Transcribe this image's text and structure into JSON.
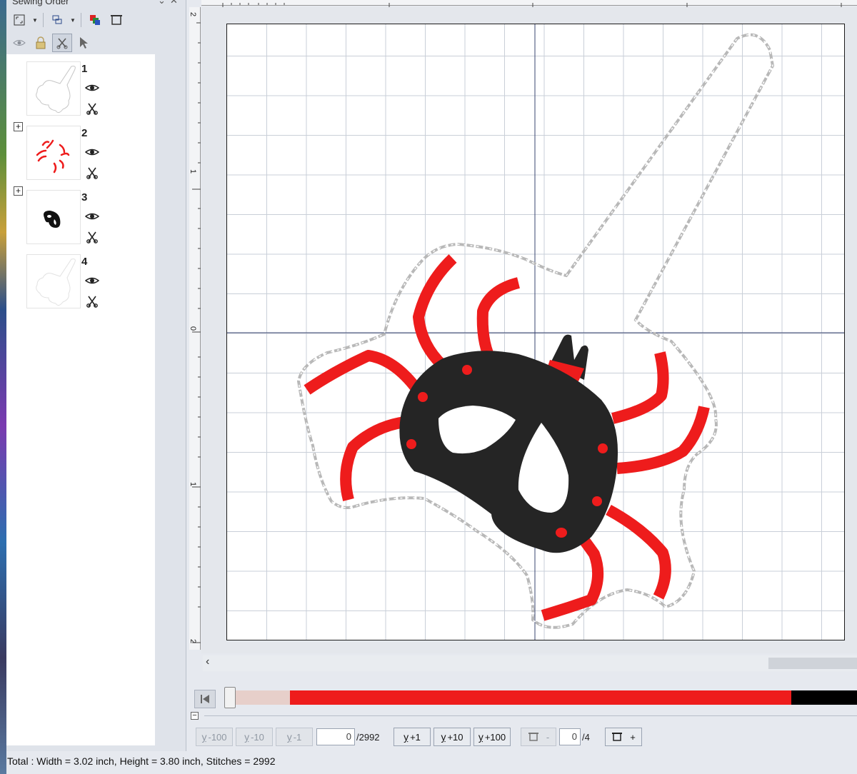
{
  "panel": {
    "title": "Sewing Order",
    "items": [
      {
        "number": "1",
        "kind": "outline"
      },
      {
        "number": "2",
        "kind": "legs"
      },
      {
        "number": "3",
        "kind": "body"
      },
      {
        "number": "4",
        "kind": "outline-light"
      }
    ]
  },
  "rulers": {
    "vertical": [
      "2",
      "1",
      "0",
      "1",
      "2"
    ]
  },
  "colors": {
    "red": "#ee1c1c",
    "black": "#252525",
    "outline": "#b8b8b8",
    "grid": "#c9cfd8",
    "progress_done": "#e7cfca",
    "progress_red": "#ee1c1c",
    "progress_black": "#000000"
  },
  "progress": {
    "fraction_done": 0.09
  },
  "stitch_controls": {
    "minus100": "-100",
    "minus10": "-10",
    "minus1": "-1",
    "current_stitch": "0",
    "total_stitches": "/2992",
    "plus1": "+1",
    "plus10": "+10",
    "plus100": "+100",
    "color_minus": "-",
    "current_color": "0",
    "total_colors": "/4",
    "color_plus": "+"
  },
  "status": {
    "total": "Total : Width = 3.02 inch, Height = 3.80 inch, Stitches = 2992"
  }
}
